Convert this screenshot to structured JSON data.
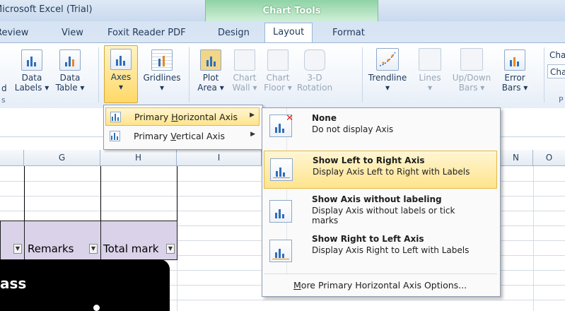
{
  "window": {
    "title": "Microsoft Excel (Trial)"
  },
  "context_tab": {
    "label": "Chart Tools",
    "color": "#8fd3a5"
  },
  "tabs": [
    {
      "label": "Review",
      "active": false
    },
    {
      "label": "View",
      "active": false
    },
    {
      "label": "Foxit Reader PDF",
      "active": false
    },
    {
      "label": "Design",
      "active": false
    },
    {
      "label": "Layout",
      "active": true
    },
    {
      "label": "Format",
      "active": false
    }
  ],
  "ribbon": {
    "labels_group": {
      "data_labels": "Data\nLabels ▾",
      "data_table": "Data\nTable ▾",
      "partial_left": "d"
    },
    "axes_group": {
      "axes": "Axes\n▾",
      "gridlines": "Gridlines\n▾"
    },
    "background_group": {
      "plot_area": "Plot\nArea ▾",
      "chart_wall": "Chart\nWall ▾",
      "chart_floor": "Chart\nFloor ▾",
      "rotation": "3-D\nRotation"
    },
    "analysis_group": {
      "trendline": "Trendline\n▾",
      "lines": "Lines\n▾",
      "updown_bars": "Up/Down\nBars ▾",
      "error_bars": "Error\nBars ▾"
    },
    "right_partial": {
      "top": "Cha",
      "box": "Cha",
      "bottom": "P"
    },
    "group_label_partial": "s"
  },
  "columns": [
    "G",
    "H",
    "I",
    "N",
    "O"
  ],
  "sheet": {
    "header_cells": {
      "remarks": "Remarks",
      "total_marks": "Total mark"
    },
    "shape_text": "ass"
  },
  "menu_axes": {
    "items": [
      {
        "label_pre": "Primary ",
        "label_u": "H",
        "label_post": "orizontal Axis",
        "highlighted": true
      },
      {
        "label_pre": "Primary ",
        "label_u": "V",
        "label_post": "ertical Axis",
        "highlighted": false
      }
    ]
  },
  "menu_horizontal": {
    "options": [
      {
        "title": "None",
        "desc": "Do not display Axis",
        "highlighted": false
      },
      {
        "title": "Show Left to Right Axis",
        "desc": "Display Axis Left to Right with Labels",
        "highlighted": true
      },
      {
        "title": "Show Axis without labeling",
        "desc": "Display Axis without labels or tick marks",
        "highlighted": false
      },
      {
        "title": "Show Right to Left Axis",
        "desc": "Display Axis Right to Left with Labels",
        "highlighted": false
      }
    ],
    "more_pre": "",
    "more_u": "M",
    "more_post": "ore Primary Horizontal Axis Options..."
  }
}
